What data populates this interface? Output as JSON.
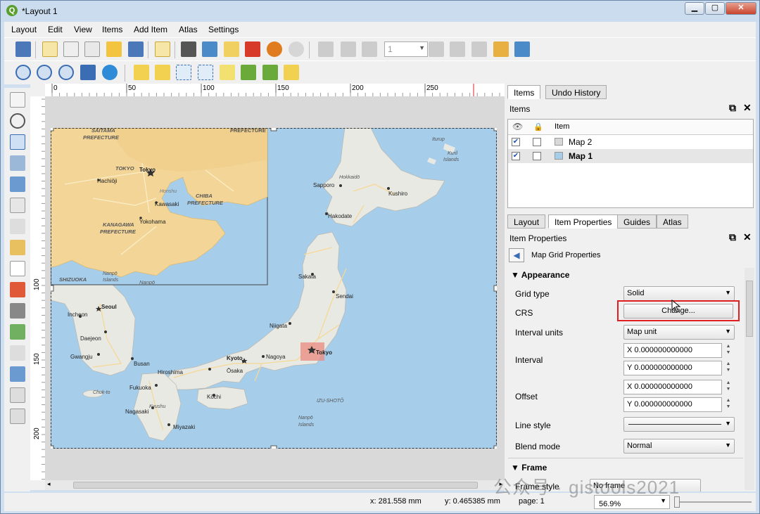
{
  "window": {
    "title": "*Layout 1",
    "min": "▁",
    "max": "▢",
    "close": "✕"
  },
  "menu": [
    "Layout",
    "Edit",
    "View",
    "Items",
    "Add Item",
    "Atlas",
    "Settings"
  ],
  "toolbar": {
    "page_number": "1"
  },
  "ruler": {
    "h_ticks": [
      "0",
      "50",
      "100",
      "150",
      "200",
      "250"
    ],
    "v_ticks": [
      "100",
      "150",
      "200"
    ]
  },
  "map": {
    "japan_labels": [
      "Sapporo",
      "Kushiro",
      "Hokkaidō",
      "Hakodate",
      "Sakata",
      "Sendai",
      "Niigata",
      "Tokyo",
      "Nagoya",
      "Kyoto",
      "Ōsaka",
      "Hiroshima",
      "Kōchi",
      "Fukuoka",
      "Kyushu",
      "Nagasaki",
      "Miyazaki",
      "Seoul",
      "Incheon",
      "Daejeon",
      "Gwangju",
      "Busan",
      "Chuk-to",
      "IZU-SHOTŌ",
      "Nanpō",
      "Islands",
      "Iturup",
      "Kuril",
      "Islands"
    ],
    "inset_labels": [
      "SAITAMA",
      "PREFECTURE",
      "PREFECTURE",
      "TOKYO",
      "Tokyo",
      "Hachiōji",
      "Honshu",
      "CHIBA",
      "PREFECTURE",
      "Kawasaki",
      "Yokohama",
      "KANAGAWA",
      "PREFECTURE",
      "SHIZUOKA",
      "Nanpō",
      "Islands"
    ],
    "colors": {
      "sea": "#a6cdea",
      "land": "#e9e9e4",
      "inset_land": "#f2d597",
      "roads": "#f5d894",
      "highlight": "#ea8f85"
    }
  },
  "right_panel": {
    "top_tabs": [
      "Items",
      "Undo History"
    ],
    "items_title": "Items",
    "items_header": "Item",
    "items": [
      {
        "label": "Map 2",
        "checked": true,
        "bold": false
      },
      {
        "label": "Map 1",
        "checked": true,
        "bold": true
      }
    ],
    "bottom_tabs": [
      "Layout",
      "Item Properties",
      "Guides",
      "Atlas"
    ],
    "props_title": "Item Properties",
    "back_label": "Map Grid Properties",
    "appearance": "Appearance",
    "grid_type_label": "Grid type",
    "grid_type_value": "Solid",
    "crs_label": "CRS",
    "crs_button": "Change...",
    "interval_units_label": "Interval units",
    "interval_units_value": "Map unit",
    "interval_label": "Interval",
    "interval_x": "X 0.000000000000",
    "interval_y": "Y 0.000000000000",
    "offset_label": "Offset",
    "offset_x": "X 0.000000000000",
    "offset_y": "Y 0.000000000000",
    "line_style_label": "Line style",
    "blend_label": "Blend mode",
    "blend_value": "Normal",
    "frame": "Frame",
    "frame_style_label": "Frame style",
    "frame_style_value": "No frame"
  },
  "status": {
    "x": "x: 281.558 mm",
    "y": "y: 0.465385 mm",
    "page": "page: 1",
    "zoom": "56.9%"
  },
  "watermark": "公众号 · gistools2021",
  "accent": "#2f6fd0",
  "highlight_red": "#e02020"
}
